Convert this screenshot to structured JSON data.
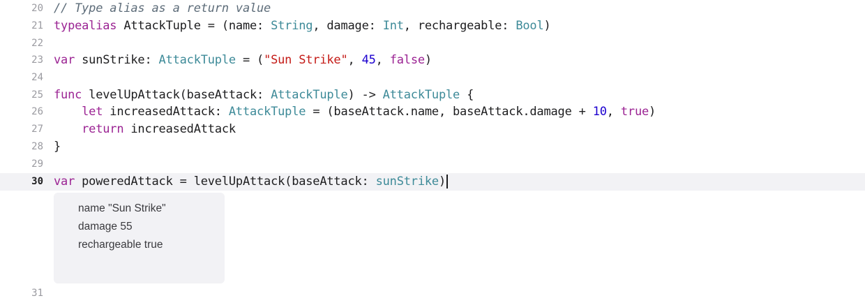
{
  "editor": {
    "lines": [
      {
        "num": "20",
        "tokens": [
          {
            "t": "// Type alias as a return value",
            "c": "cm"
          }
        ]
      },
      {
        "num": "21",
        "tokens": [
          {
            "t": "typealias",
            "c": "kw"
          },
          {
            "t": " AttackTuple = (name: ",
            "c": ""
          },
          {
            "t": "String",
            "c": "type"
          },
          {
            "t": ", damage: ",
            "c": ""
          },
          {
            "t": "Int",
            "c": "type"
          },
          {
            "t": ", rechargeable: ",
            "c": ""
          },
          {
            "t": "Bool",
            "c": "type"
          },
          {
            "t": ")",
            "c": ""
          }
        ]
      },
      {
        "num": "22",
        "tokens": []
      },
      {
        "num": "23",
        "tokens": [
          {
            "t": "var",
            "c": "kw"
          },
          {
            "t": " sunStrike: ",
            "c": ""
          },
          {
            "t": "AttackTuple",
            "c": "type"
          },
          {
            "t": " = (",
            "c": ""
          },
          {
            "t": "\"Sun Strike\"",
            "c": "str"
          },
          {
            "t": ", ",
            "c": ""
          },
          {
            "t": "45",
            "c": "num"
          },
          {
            "t": ", ",
            "c": ""
          },
          {
            "t": "false",
            "c": "kw"
          },
          {
            "t": ")",
            "c": ""
          }
        ]
      },
      {
        "num": "24",
        "tokens": []
      },
      {
        "num": "25",
        "tokens": [
          {
            "t": "func",
            "c": "kw"
          },
          {
            "t": " levelUpAttack(baseAttack: ",
            "c": ""
          },
          {
            "t": "AttackTuple",
            "c": "type"
          },
          {
            "t": ") -> ",
            "c": ""
          },
          {
            "t": "AttackTuple",
            "c": "type"
          },
          {
            "t": " {",
            "c": ""
          }
        ]
      },
      {
        "num": "26",
        "tokens": [
          {
            "t": "    ",
            "c": ""
          },
          {
            "t": "let",
            "c": "kw"
          },
          {
            "t": " increasedAttack: ",
            "c": ""
          },
          {
            "t": "AttackTuple",
            "c": "type"
          },
          {
            "t": " = (baseAttack.name, baseAttack.damage + ",
            "c": ""
          },
          {
            "t": "10",
            "c": "num"
          },
          {
            "t": ", ",
            "c": ""
          },
          {
            "t": "true",
            "c": "kw"
          },
          {
            "t": ")",
            "c": ""
          }
        ]
      },
      {
        "num": "27",
        "tokens": [
          {
            "t": "    ",
            "c": ""
          },
          {
            "t": "return",
            "c": "kw"
          },
          {
            "t": " increasedAttack",
            "c": ""
          }
        ]
      },
      {
        "num": "28",
        "tokens": [
          {
            "t": "}",
            "c": ""
          }
        ]
      },
      {
        "num": "29",
        "tokens": []
      },
      {
        "num": "30",
        "current": true,
        "tokens": [
          {
            "t": "var",
            "c": "kw"
          },
          {
            "t": " poweredAttack = levelUpAttack(baseAttack: ",
            "c": ""
          },
          {
            "t": "sunStrike",
            "c": "type"
          },
          {
            "t": ")",
            "c": ""
          }
        ]
      },
      {
        "num": "31",
        "tokens": []
      }
    ],
    "result_popover": {
      "rows": [
        "name \"Sun Strike\"",
        "damage 55",
        "rechargeable true"
      ]
    }
  }
}
